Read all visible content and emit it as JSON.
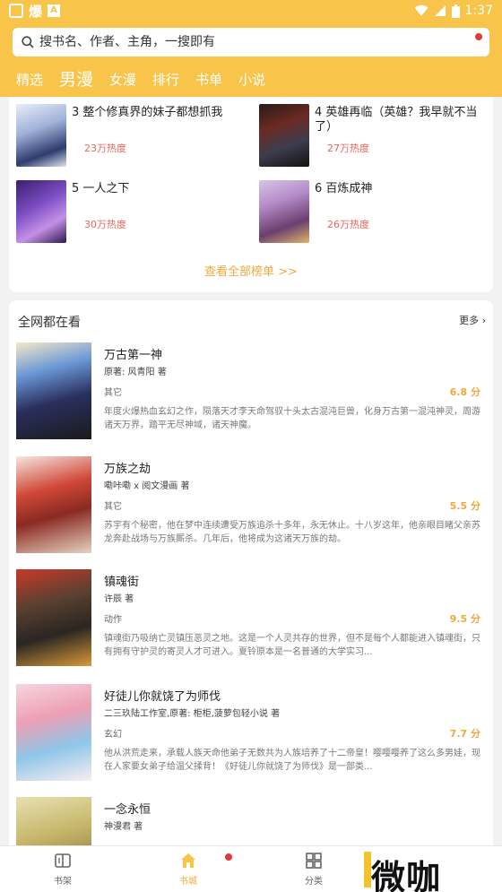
{
  "status": {
    "app_name": "爆",
    "badge": "A",
    "time": "1:37"
  },
  "search": {
    "placeholder": "搜书名、作者、主角，一搜即有"
  },
  "tabs": [
    {
      "label": "精选"
    },
    {
      "label": "男漫"
    },
    {
      "label": "女漫"
    },
    {
      "label": "排行"
    },
    {
      "label": "书单"
    },
    {
      "label": "小说"
    }
  ],
  "rank": {
    "items": [
      {
        "title": "3 整个修真界的妹子都想抓我",
        "heat": "23万热度"
      },
      {
        "title": "4 英雄再临（英雄？我早就不当了）",
        "heat": "27万热度"
      },
      {
        "title": "5 一人之下",
        "heat": "30万热度"
      },
      {
        "title": "6 百炼成神",
        "heat": "26万热度"
      }
    ],
    "see_all": "查看全部榜单 >>"
  },
  "net": {
    "title": "全网都在看",
    "more": "更多",
    "books": [
      {
        "title": "万古第一神",
        "author": "原著: 风青阳 著",
        "genre": "其它",
        "score": "6.8 分",
        "desc": "年度火爆热血玄幻之作，陨落天才李天命驾驭十头太古混沌巨兽，化身万古第一混沌神灵，周游诸天万界，踏平无尽神域，诸天神魔。"
      },
      {
        "title": "万族之劫",
        "author": "嘞咔嘞 x 阅文漫画 著",
        "genre": "其它",
        "score": "5.5 分",
        "desc": "苏宇有个秘密，他在梦中连续遭受万族追杀十多年，永无休止。十八岁这年，他亲眼目睹父亲苏龙奔赴战场与万族厮杀。几年后，他将成为这诸天万族的劫。"
      },
      {
        "title": "镇魂街",
        "author": "许辰 著",
        "genre": "动作",
        "score": "9.5 分",
        "desc": "镇魂街乃吸纳亡灵镇压恶灵之地。这是一个人灵共存的世界，但不是每个人都能进入镇魂街，只有拥有守护灵的寄灵人才可进入。夏铃原本是一名普通的大学实习..."
      },
      {
        "title": "好徒儿你就饶了为师伐",
        "author": "二三玖陆工作室,原著: 柜柜,菠萝包轻小说 著",
        "genre": "玄幻",
        "score": "7.7 分",
        "desc": "他从洪荒走来，承载人族天命他弟子无数共为人族培养了十二帝皇！嘤嘤嘤养了这么多男娃，现在人家要女弟子给温父揉背！《好徒儿你就饶了为师伐》是一部类..."
      },
      {
        "title": "一念永恒",
        "author": "神漫君 著",
        "genre": "",
        "score": "",
        "desc": ""
      }
    ]
  },
  "bottom_nav": [
    {
      "label": "书架"
    },
    {
      "label": "书城"
    },
    {
      "label": "分类"
    }
  ],
  "watermark": {
    "text": "微咖"
  },
  "colors": {
    "accent": "#f9c44a",
    "orange_text": "#f2a83c",
    "heat_red": "#e8665a",
    "dot_red": "#e53935"
  }
}
